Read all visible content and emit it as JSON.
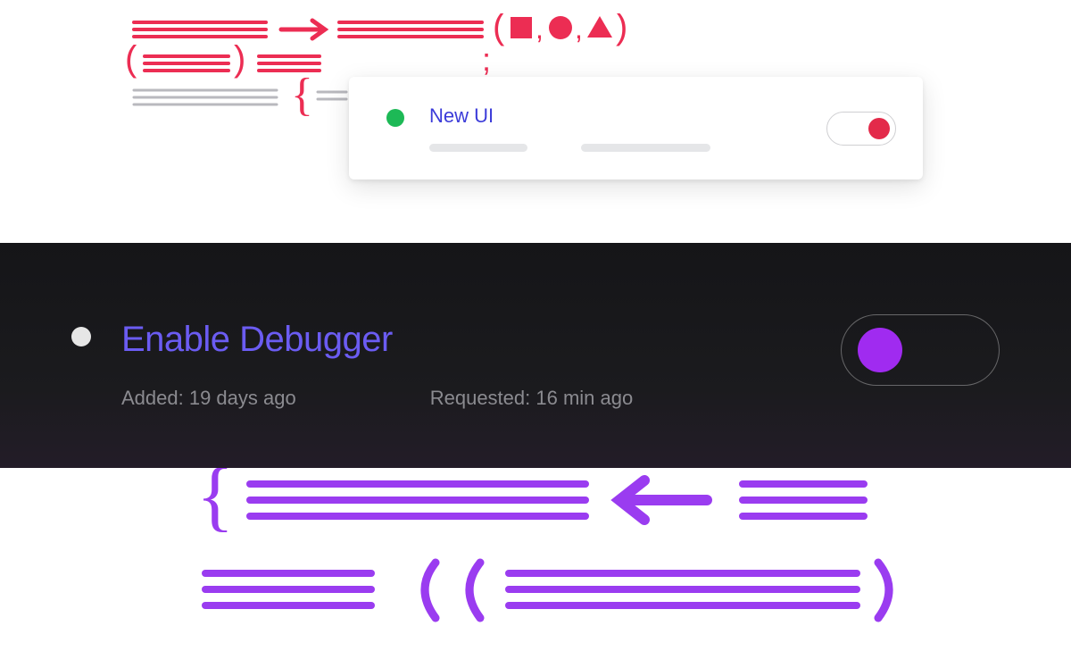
{
  "cards": {
    "new_ui": {
      "title": "New UI",
      "status_color": "#1db956",
      "toggle_state": "on",
      "toggle_color": "#e32a4a"
    },
    "enable_debugger": {
      "title": "Enable Debugger",
      "status_color": "#e6e6e6",
      "added_label": "Added: 19 days ago",
      "requested_label": "Requested: 16 min ago",
      "toggle_state": "off",
      "toggle_color": "#a02bf0"
    }
  },
  "colors": {
    "deco_red": "#ec2d53",
    "deco_purple": "#9a3cf0",
    "title_blue": "#3b3bd9",
    "title_purple": "#6b5cf2"
  }
}
